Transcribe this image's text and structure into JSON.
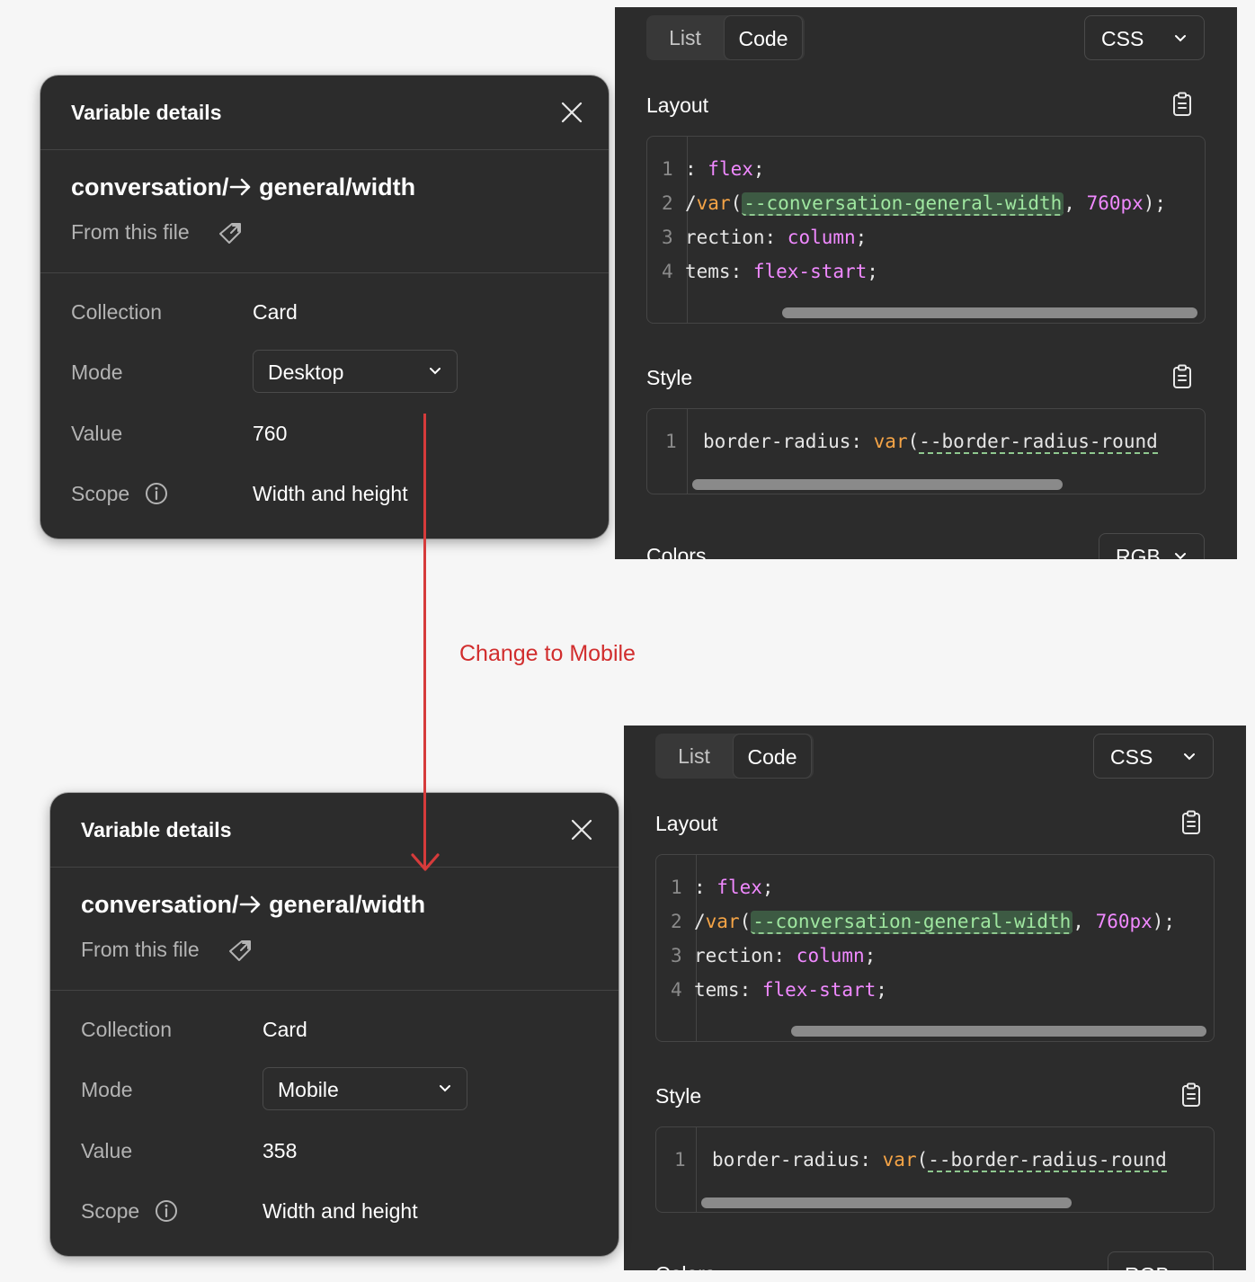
{
  "annotation": {
    "label": "Change to Mobile",
    "color": "#d12d2d"
  },
  "top": {
    "variable_panel": {
      "title": "Variable details",
      "name_prefix": "conversation/",
      "name_suffix": "general/width",
      "source": "From this file",
      "collection_label": "Collection",
      "collection_value": "Card",
      "mode_label": "Mode",
      "mode_value": "Desktop",
      "value_label": "Value",
      "value": "760",
      "scope_label": "Scope",
      "scope_value": "Width and height"
    },
    "code_panel": {
      "tab_list": "List",
      "tab_code": "Code",
      "language": "CSS",
      "layout_label": "Layout",
      "style_label": "Style",
      "colors_label": "Colors",
      "color_format": "RGB",
      "layout_lines": [
        {
          "n": "1",
          "pre": ": ",
          "kw": "flex",
          "post": ";"
        },
        {
          "n": "2",
          "pre": "/",
          "fn": "var",
          "open": "(",
          "var": "--conversation-general-width",
          "sep": ", ",
          "num": "760px",
          "close": ");"
        },
        {
          "n": "3",
          "pre": "rection: ",
          "kw": "column",
          "post": ";"
        },
        {
          "n": "4",
          "pre": "tems: ",
          "kw": "flex-start",
          "post": ";"
        }
      ],
      "style_lines": [
        {
          "n": "1",
          "prop": "border-radius: ",
          "fn": "var",
          "open": "(",
          "var": "--border-radius-round"
        }
      ]
    }
  },
  "bottom": {
    "variable_panel": {
      "title": "Variable details",
      "name_prefix": "conversation/",
      "name_suffix": "general/width",
      "source": "From this file",
      "collection_label": "Collection",
      "collection_value": "Card",
      "mode_label": "Mode",
      "mode_value": "Mobile",
      "value_label": "Value",
      "value": "358",
      "scope_label": "Scope",
      "scope_value": "Width and height"
    },
    "code_panel": {
      "tab_list": "List",
      "tab_code": "Code",
      "language": "CSS",
      "layout_label": "Layout",
      "style_label": "Style",
      "colors_label": "Colors",
      "color_format": "RGB",
      "layout_lines": [
        {
          "n": "1",
          "pre": ": ",
          "kw": "flex",
          "post": ";"
        },
        {
          "n": "2",
          "pre": "/",
          "fn": "var",
          "open": "(",
          "var": "--conversation-general-width",
          "sep": ", ",
          "num": "760px",
          "close": ");"
        },
        {
          "n": "3",
          "pre": "rection: ",
          "kw": "column",
          "post": ";"
        },
        {
          "n": "4",
          "pre": "tems: ",
          "kw": "flex-start",
          "post": ";"
        }
      ],
      "style_lines": [
        {
          "n": "1",
          "prop": "border-radius: ",
          "fn": "var",
          "open": "(",
          "var": "--border-radius-round"
        }
      ]
    }
  }
}
